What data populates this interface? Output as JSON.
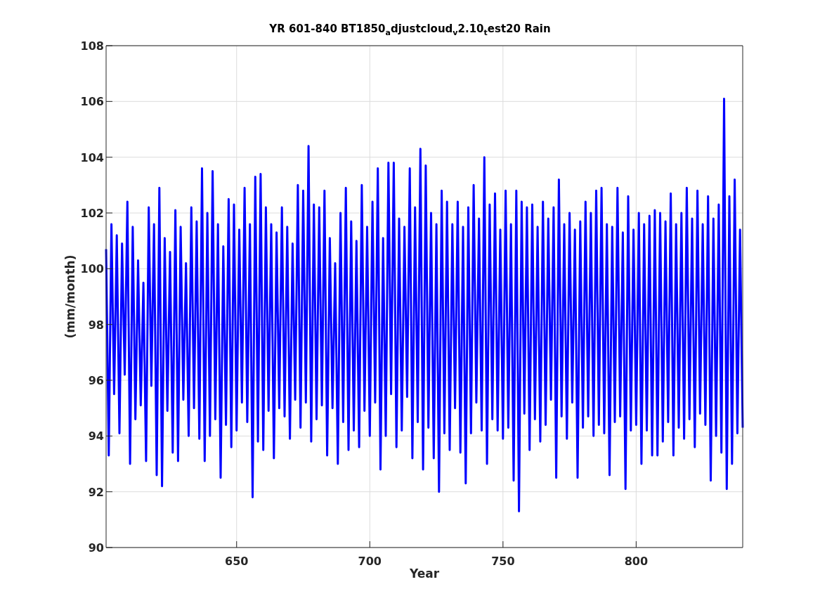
{
  "figure": {
    "chart_data": {
      "type": "line",
      "title": "YR 601-840 BT1850$_{a}$djustcloud$_{v}$2.10$_{t}$est20 Rain",
      "xlabel": "Year",
      "ylabel": "(mm/month)",
      "xlim": [
        601,
        840
      ],
      "ylim": [
        90,
        108
      ],
      "xticks": [
        650,
        700,
        750,
        800
      ],
      "yticks": [
        90,
        92,
        94,
        96,
        98,
        100,
        102,
        104,
        106,
        108
      ],
      "grid": true,
      "x": [
        601,
        602,
        603,
        604,
        605,
        606,
        607,
        608,
        609,
        610,
        611,
        612,
        613,
        614,
        615,
        616,
        617,
        618,
        619,
        620,
        621,
        622,
        623,
        624,
        625,
        626,
        627,
        628,
        629,
        630,
        631,
        632,
        633,
        634,
        635,
        636,
        637,
        638,
        639,
        640,
        641,
        642,
        643,
        644,
        645,
        646,
        647,
        648,
        649,
        650,
        651,
        652,
        653,
        654,
        655,
        656,
        657,
        658,
        659,
        660,
        661,
        662,
        663,
        664,
        665,
        666,
        667,
        668,
        669,
        670,
        671,
        672,
        673,
        674,
        675,
        676,
        677,
        678,
        679,
        680,
        681,
        682,
        683,
        684,
        685,
        686,
        687,
        688,
        689,
        690,
        691,
        692,
        693,
        694,
        695,
        696,
        697,
        698,
        699,
        700,
        701,
        702,
        703,
        704,
        705,
        706,
        707,
        708,
        709,
        710,
        711,
        712,
        713,
        714,
        715,
        716,
        717,
        718,
        719,
        720,
        721,
        722,
        723,
        724,
        725,
        726,
        727,
        728,
        729,
        730,
        731,
        732,
        733,
        734,
        735,
        736,
        737,
        738,
        739,
        740,
        741,
        742,
        743,
        744,
        745,
        746,
        747,
        748,
        749,
        750,
        751,
        752,
        753,
        754,
        755,
        756,
        757,
        758,
        759,
        760,
        761,
        762,
        763,
        764,
        765,
        766,
        767,
        768,
        769,
        770,
        771,
        772,
        773,
        774,
        775,
        776,
        777,
        778,
        779,
        780,
        781,
        782,
        783,
        784,
        785,
        786,
        787,
        788,
        789,
        790,
        791,
        792,
        793,
        794,
        795,
        796,
        797,
        798,
        799,
        800,
        801,
        802,
        803,
        804,
        805,
        806,
        807,
        808,
        809,
        810,
        811,
        812,
        813,
        814,
        815,
        816,
        817,
        818,
        819,
        820,
        821,
        822,
        823,
        824,
        825,
        826,
        827,
        828,
        829,
        830,
        831,
        832,
        833,
        834,
        835,
        836,
        837,
        838,
        839,
        840
      ],
      "series": [
        {
          "color": "#0000ff",
          "values": [
            100.7,
            93.3,
            101.6,
            95.5,
            101.2,
            94.1,
            100.9,
            96.2,
            102.4,
            93.0,
            101.5,
            94.6,
            100.3,
            95.1,
            99.5,
            93.1,
            102.2,
            95.8,
            101.6,
            92.6,
            102.9,
            92.2,
            101.1,
            94.9,
            100.6,
            93.4,
            102.1,
            93.1,
            101.5,
            95.3,
            100.2,
            94.0,
            102.2,
            95.0,
            101.7,
            93.9,
            103.6,
            93.1,
            102.0,
            94.0,
            103.5,
            94.6,
            101.6,
            92.5,
            100.8,
            94.4,
            102.5,
            93.6,
            102.3,
            94.2,
            101.4,
            95.2,
            102.9,
            94.5,
            101.6,
            91.8,
            103.3,
            93.8,
            103.4,
            93.5,
            102.2,
            94.9,
            101.6,
            93.2,
            101.3,
            95.0,
            102.2,
            94.7,
            101.5,
            93.9,
            100.9,
            95.3,
            103.0,
            94.3,
            102.8,
            95.2,
            104.4,
            93.8,
            102.3,
            94.6,
            102.2,
            95.1,
            102.8,
            93.3,
            101.1,
            95.0,
            100.2,
            93.0,
            102.0,
            94.5,
            102.9,
            93.5,
            101.7,
            94.2,
            101.0,
            93.6,
            103.0,
            94.9,
            101.5,
            94.0,
            102.4,
            95.2,
            103.6,
            92.8,
            101.1,
            94.0,
            103.8,
            95.5,
            103.8,
            93.6,
            101.8,
            94.2,
            101.5,
            95.4,
            103.6,
            93.2,
            102.2,
            94.5,
            104.3,
            92.8,
            103.7,
            94.3,
            102.0,
            93.2,
            101.6,
            92.0,
            102.8,
            94.1,
            102.4,
            93.5,
            101.6,
            95.0,
            102.4,
            93.4,
            101.5,
            92.3,
            102.2,
            94.1,
            103.0,
            95.2,
            101.8,
            94.2,
            104.0,
            93.0,
            102.3,
            94.6,
            102.7,
            94.2,
            101.4,
            93.9,
            102.8,
            94.3,
            101.6,
            92.4,
            102.8,
            91.3,
            102.4,
            94.8,
            102.2,
            93.5,
            102.3,
            94.6,
            101.5,
            93.8,
            102.4,
            94.4,
            101.8,
            95.3,
            102.2,
            92.5,
            103.2,
            94.7,
            101.6,
            93.9,
            102.0,
            95.2,
            101.4,
            92.5,
            101.7,
            94.3,
            102.4,
            94.7,
            102.0,
            94.0,
            102.8,
            94.4,
            102.9,
            94.1,
            101.6,
            92.6,
            101.5,
            94.5,
            102.9,
            94.7,
            101.3,
            92.1,
            102.6,
            94.2,
            101.4,
            94.4,
            102.0,
            93.0,
            101.6,
            94.2,
            101.9,
            93.3,
            102.1,
            93.3,
            102.0,
            93.8,
            101.7,
            94.5,
            102.7,
            93.3,
            101.6,
            94.3,
            102.0,
            93.9,
            102.9,
            94.6,
            101.8,
            93.6,
            102.8,
            94.8,
            101.6,
            94.4,
            102.6,
            92.4,
            101.8,
            94.0,
            102.3,
            93.4,
            106.1,
            92.1,
            102.6,
            93.0,
            103.2,
            94.1,
            101.4,
            94.3
          ]
        }
      ]
    }
  }
}
